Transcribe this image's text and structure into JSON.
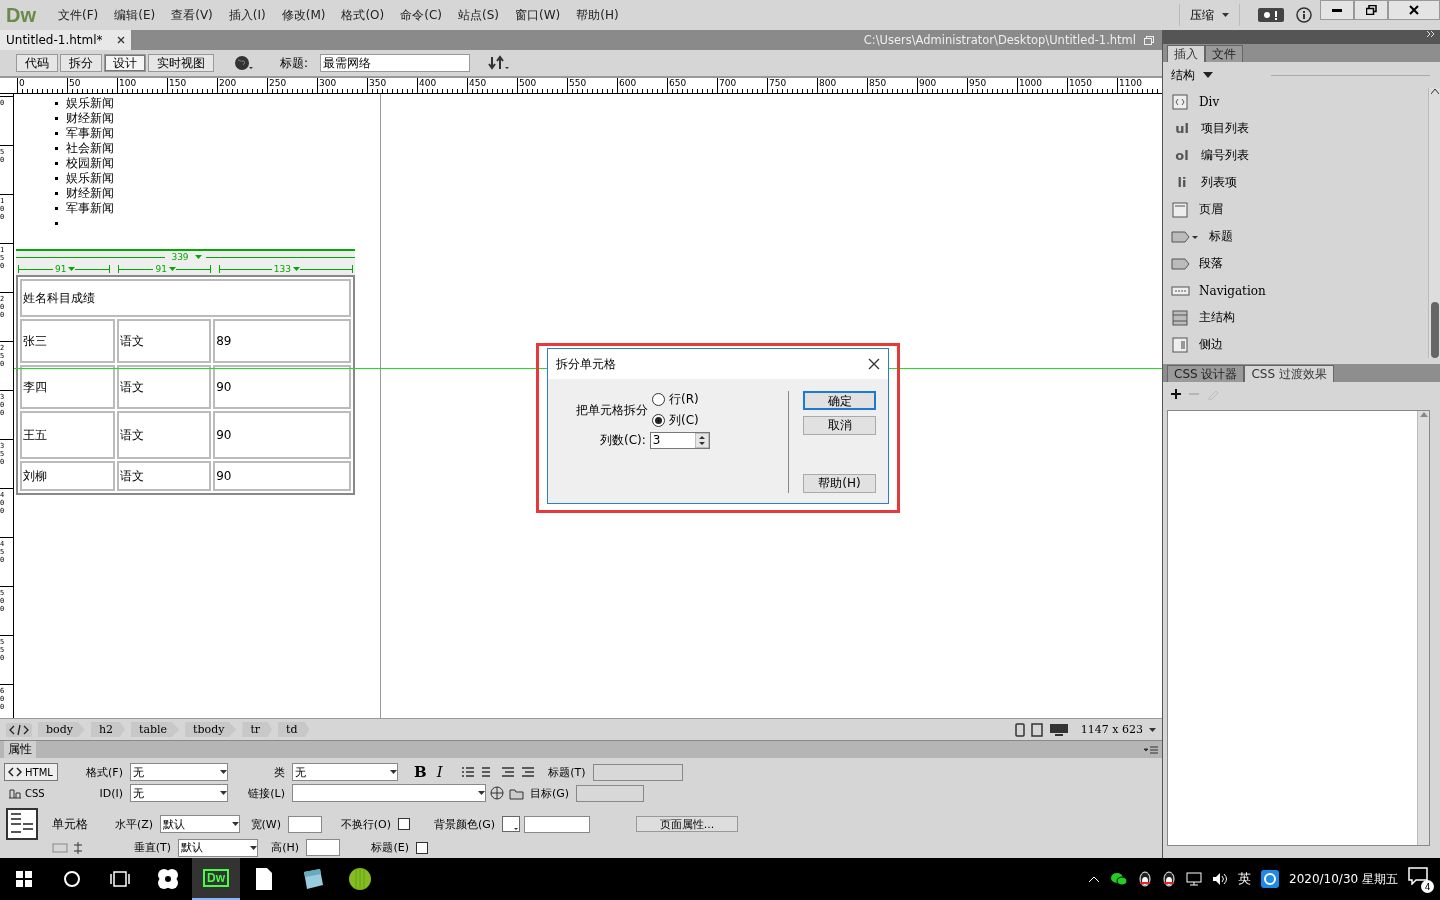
{
  "app": {
    "logo": "Dw",
    "menu": [
      "文件(F)",
      "编辑(E)",
      "查看(V)",
      "插入(I)",
      "修改(M)",
      "格式(O)",
      "命令(C)",
      "站点(S)",
      "窗口(W)",
      "帮助(H)"
    ],
    "workspace": "压缩"
  },
  "document": {
    "tab": "Untitled-1.html*",
    "path": "C:\\Users\\Administrator\\Desktop\\Untitled-1.html"
  },
  "toolbar": {
    "views": [
      {
        "label": "代码",
        "selected": false
      },
      {
        "label": "拆分",
        "selected": false
      },
      {
        "label": "设计",
        "selected": true
      },
      {
        "label": "实时视图",
        "selected": false
      }
    ],
    "title_label": "标题:",
    "title_value": "最需网络"
  },
  "ruler": {
    "h_labels": [
      "0",
      "50",
      "100",
      "150",
      "200",
      "250",
      "300",
      "350",
      "400",
      "450",
      "500",
      "550",
      "600",
      "650",
      "700",
      "750",
      "800",
      "850",
      "900",
      "950",
      "1000",
      "1050",
      "1100"
    ],
    "v_labels": [
      "0",
      "50",
      "100",
      "150",
      "200",
      "250",
      "300",
      "350",
      "400",
      "450",
      "500",
      "550",
      "600"
    ]
  },
  "canvas": {
    "list_items": [
      "娱乐新闻",
      "财经新闻",
      "军事新闻",
      "社会新闻",
      "校园新闻",
      "娱乐新闻",
      "财经新闻",
      "军事新闻"
    ],
    "trailing_empty_item": true,
    "table": {
      "width_label": "339",
      "column_widths": [
        "91",
        "91",
        "133"
      ],
      "header": "姓名科目成绩",
      "rows": [
        [
          "张三",
          "语文",
          "89"
        ],
        [
          "李四",
          "语文",
          "90"
        ],
        [
          "王五",
          "语文",
          "90"
        ],
        [
          "刘柳",
          "语文",
          "90"
        ]
      ]
    }
  },
  "dialog": {
    "title": "拆分单元格",
    "split_label": "把单元格拆分",
    "options": [
      {
        "label": "行(R)",
        "selected": false
      },
      {
        "label": "列(C)",
        "selected": true
      }
    ],
    "count_label": "列数(C):",
    "count_value": "3",
    "buttons": [
      "确定",
      "取消",
      "帮助(H)"
    ]
  },
  "tag_bar": {
    "tags": [
      "body",
      "h2",
      "table",
      "tbody",
      "tr",
      "td"
    ],
    "size": "1147 x 623"
  },
  "properties": {
    "title": "属性",
    "modes": [
      {
        "label": "HTML",
        "selected": true
      },
      {
        "label": "CSS",
        "selected": false
      }
    ],
    "format_label": "格式(F)",
    "format_value": "无",
    "id_label": "ID(I)",
    "id_value": "无",
    "class_label": "类",
    "class_value": "无",
    "link_label": "链接(L)",
    "title_label": "标题(T)",
    "text_styles": [
      "B",
      "I"
    ],
    "target_label": "目标(G)",
    "cell_label": "单元格",
    "horiz_label": "水平(Z)",
    "horiz_value": "默认",
    "vert_label": "垂直(T)",
    "vert_value": "默认",
    "width_label": "宽(W)",
    "height_label": "高(H)",
    "nowrap_label": "不换行(O)",
    "nowrap": false,
    "header_label": "标题(E)",
    "header": false,
    "bg_label": "背景颜色(G)",
    "page_props": "页面属性..."
  },
  "insert_panel": {
    "tabs": [
      {
        "label": "插入",
        "selected": true
      },
      {
        "label": "文件",
        "selected": false
      }
    ],
    "category": "结构",
    "items": [
      {
        "kind": "icon",
        "label": "Div"
      },
      {
        "kind": "text",
        "badge": "ul",
        "label": "项目列表"
      },
      {
        "kind": "text",
        "badge": "ol",
        "label": "编号列表"
      },
      {
        "kind": "text",
        "badge": "li",
        "label": "列表项"
      },
      {
        "kind": "icon",
        "label": "页眉"
      },
      {
        "kind": "icon",
        "label": "标题"
      },
      {
        "kind": "icon",
        "label": "段落"
      },
      {
        "kind": "icon",
        "label": "Navigation"
      },
      {
        "kind": "icon",
        "label": "主结构"
      },
      {
        "kind": "icon",
        "label": "侧边"
      }
    ]
  },
  "css_panel": {
    "tabs": [
      {
        "label": "CSS 设计器",
        "selected": false
      },
      {
        "label": "CSS 过渡效果",
        "selected": true
      }
    ]
  },
  "taskbar": {
    "dw_label": "Dw",
    "ime": "英",
    "date": "2020/10/30 星期五",
    "notifications": "4"
  }
}
